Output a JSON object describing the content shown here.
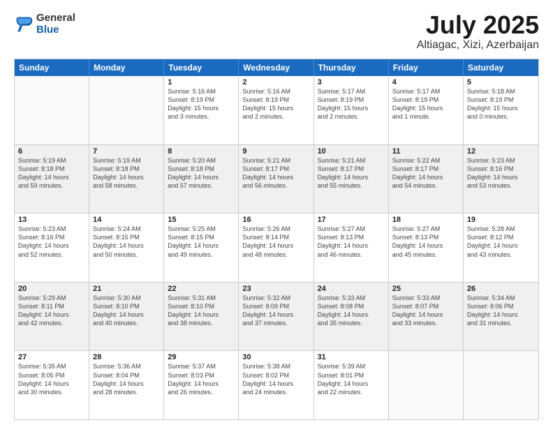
{
  "logo": {
    "general": "General",
    "blue": "Blue"
  },
  "header": {
    "month": "July 2025",
    "location": "Altiagac, Xizi, Azerbaijan"
  },
  "weekdays": [
    "Sunday",
    "Monday",
    "Tuesday",
    "Wednesday",
    "Thursday",
    "Friday",
    "Saturday"
  ],
  "weeks": [
    [
      {
        "day": "",
        "lines": []
      },
      {
        "day": "",
        "lines": []
      },
      {
        "day": "1",
        "lines": [
          "Sunrise: 5:16 AM",
          "Sunset: 8:19 PM",
          "Daylight: 15 hours",
          "and 3 minutes."
        ]
      },
      {
        "day": "2",
        "lines": [
          "Sunrise: 5:16 AM",
          "Sunset: 8:19 PM",
          "Daylight: 15 hours",
          "and 2 minutes."
        ]
      },
      {
        "day": "3",
        "lines": [
          "Sunrise: 5:17 AM",
          "Sunset: 8:19 PM",
          "Daylight: 15 hours",
          "and 2 minutes."
        ]
      },
      {
        "day": "4",
        "lines": [
          "Sunrise: 5:17 AM",
          "Sunset: 8:19 PM",
          "Daylight: 15 hours",
          "and 1 minute."
        ]
      },
      {
        "day": "5",
        "lines": [
          "Sunrise: 5:18 AM",
          "Sunset: 8:19 PM",
          "Daylight: 15 hours",
          "and 0 minutes."
        ]
      }
    ],
    [
      {
        "day": "6",
        "lines": [
          "Sunrise: 5:19 AM",
          "Sunset: 8:18 PM",
          "Daylight: 14 hours",
          "and 59 minutes."
        ]
      },
      {
        "day": "7",
        "lines": [
          "Sunrise: 5:19 AM",
          "Sunset: 8:18 PM",
          "Daylight: 14 hours",
          "and 58 minutes."
        ]
      },
      {
        "day": "8",
        "lines": [
          "Sunrise: 5:20 AM",
          "Sunset: 8:18 PM",
          "Daylight: 14 hours",
          "and 57 minutes."
        ]
      },
      {
        "day": "9",
        "lines": [
          "Sunrise: 5:21 AM",
          "Sunset: 8:17 PM",
          "Daylight: 14 hours",
          "and 56 minutes."
        ]
      },
      {
        "day": "10",
        "lines": [
          "Sunrise: 5:21 AM",
          "Sunset: 8:17 PM",
          "Daylight: 14 hours",
          "and 55 minutes."
        ]
      },
      {
        "day": "11",
        "lines": [
          "Sunrise: 5:22 AM",
          "Sunset: 8:17 PM",
          "Daylight: 14 hours",
          "and 54 minutes."
        ]
      },
      {
        "day": "12",
        "lines": [
          "Sunrise: 5:23 AM",
          "Sunset: 8:16 PM",
          "Daylight: 14 hours",
          "and 53 minutes."
        ]
      }
    ],
    [
      {
        "day": "13",
        "lines": [
          "Sunrise: 5:23 AM",
          "Sunset: 8:16 PM",
          "Daylight: 14 hours",
          "and 52 minutes."
        ]
      },
      {
        "day": "14",
        "lines": [
          "Sunrise: 5:24 AM",
          "Sunset: 8:15 PM",
          "Daylight: 14 hours",
          "and 50 minutes."
        ]
      },
      {
        "day": "15",
        "lines": [
          "Sunrise: 5:25 AM",
          "Sunset: 8:15 PM",
          "Daylight: 14 hours",
          "and 49 minutes."
        ]
      },
      {
        "day": "16",
        "lines": [
          "Sunrise: 5:26 AM",
          "Sunset: 8:14 PM",
          "Daylight: 14 hours",
          "and 48 minutes."
        ]
      },
      {
        "day": "17",
        "lines": [
          "Sunrise: 5:27 AM",
          "Sunset: 8:13 PM",
          "Daylight: 14 hours",
          "and 46 minutes."
        ]
      },
      {
        "day": "18",
        "lines": [
          "Sunrise: 5:27 AM",
          "Sunset: 8:13 PM",
          "Daylight: 14 hours",
          "and 45 minutes."
        ]
      },
      {
        "day": "19",
        "lines": [
          "Sunrise: 5:28 AM",
          "Sunset: 8:12 PM",
          "Daylight: 14 hours",
          "and 43 minutes."
        ]
      }
    ],
    [
      {
        "day": "20",
        "lines": [
          "Sunrise: 5:29 AM",
          "Sunset: 8:11 PM",
          "Daylight: 14 hours",
          "and 42 minutes."
        ]
      },
      {
        "day": "21",
        "lines": [
          "Sunrise: 5:30 AM",
          "Sunset: 8:10 PM",
          "Daylight: 14 hours",
          "and 40 minutes."
        ]
      },
      {
        "day": "22",
        "lines": [
          "Sunrise: 5:31 AM",
          "Sunset: 8:10 PM",
          "Daylight: 14 hours",
          "and 38 minutes."
        ]
      },
      {
        "day": "23",
        "lines": [
          "Sunrise: 5:32 AM",
          "Sunset: 8:09 PM",
          "Daylight: 14 hours",
          "and 37 minutes."
        ]
      },
      {
        "day": "24",
        "lines": [
          "Sunrise: 5:33 AM",
          "Sunset: 8:08 PM",
          "Daylight: 14 hours",
          "and 35 minutes."
        ]
      },
      {
        "day": "25",
        "lines": [
          "Sunrise: 5:33 AM",
          "Sunset: 8:07 PM",
          "Daylight: 14 hours",
          "and 33 minutes."
        ]
      },
      {
        "day": "26",
        "lines": [
          "Sunrise: 5:34 AM",
          "Sunset: 8:06 PM",
          "Daylight: 14 hours",
          "and 31 minutes."
        ]
      }
    ],
    [
      {
        "day": "27",
        "lines": [
          "Sunrise: 5:35 AM",
          "Sunset: 8:05 PM",
          "Daylight: 14 hours",
          "and 30 minutes."
        ]
      },
      {
        "day": "28",
        "lines": [
          "Sunrise: 5:36 AM",
          "Sunset: 8:04 PM",
          "Daylight: 14 hours",
          "and 28 minutes."
        ]
      },
      {
        "day": "29",
        "lines": [
          "Sunrise: 5:37 AM",
          "Sunset: 8:03 PM",
          "Daylight: 14 hours",
          "and 26 minutes."
        ]
      },
      {
        "day": "30",
        "lines": [
          "Sunrise: 5:38 AM",
          "Sunset: 8:02 PM",
          "Daylight: 14 hours",
          "and 24 minutes."
        ]
      },
      {
        "day": "31",
        "lines": [
          "Sunrise: 5:39 AM",
          "Sunset: 8:01 PM",
          "Daylight: 14 hours",
          "and 22 minutes."
        ]
      },
      {
        "day": "",
        "lines": []
      },
      {
        "day": "",
        "lines": []
      }
    ]
  ]
}
